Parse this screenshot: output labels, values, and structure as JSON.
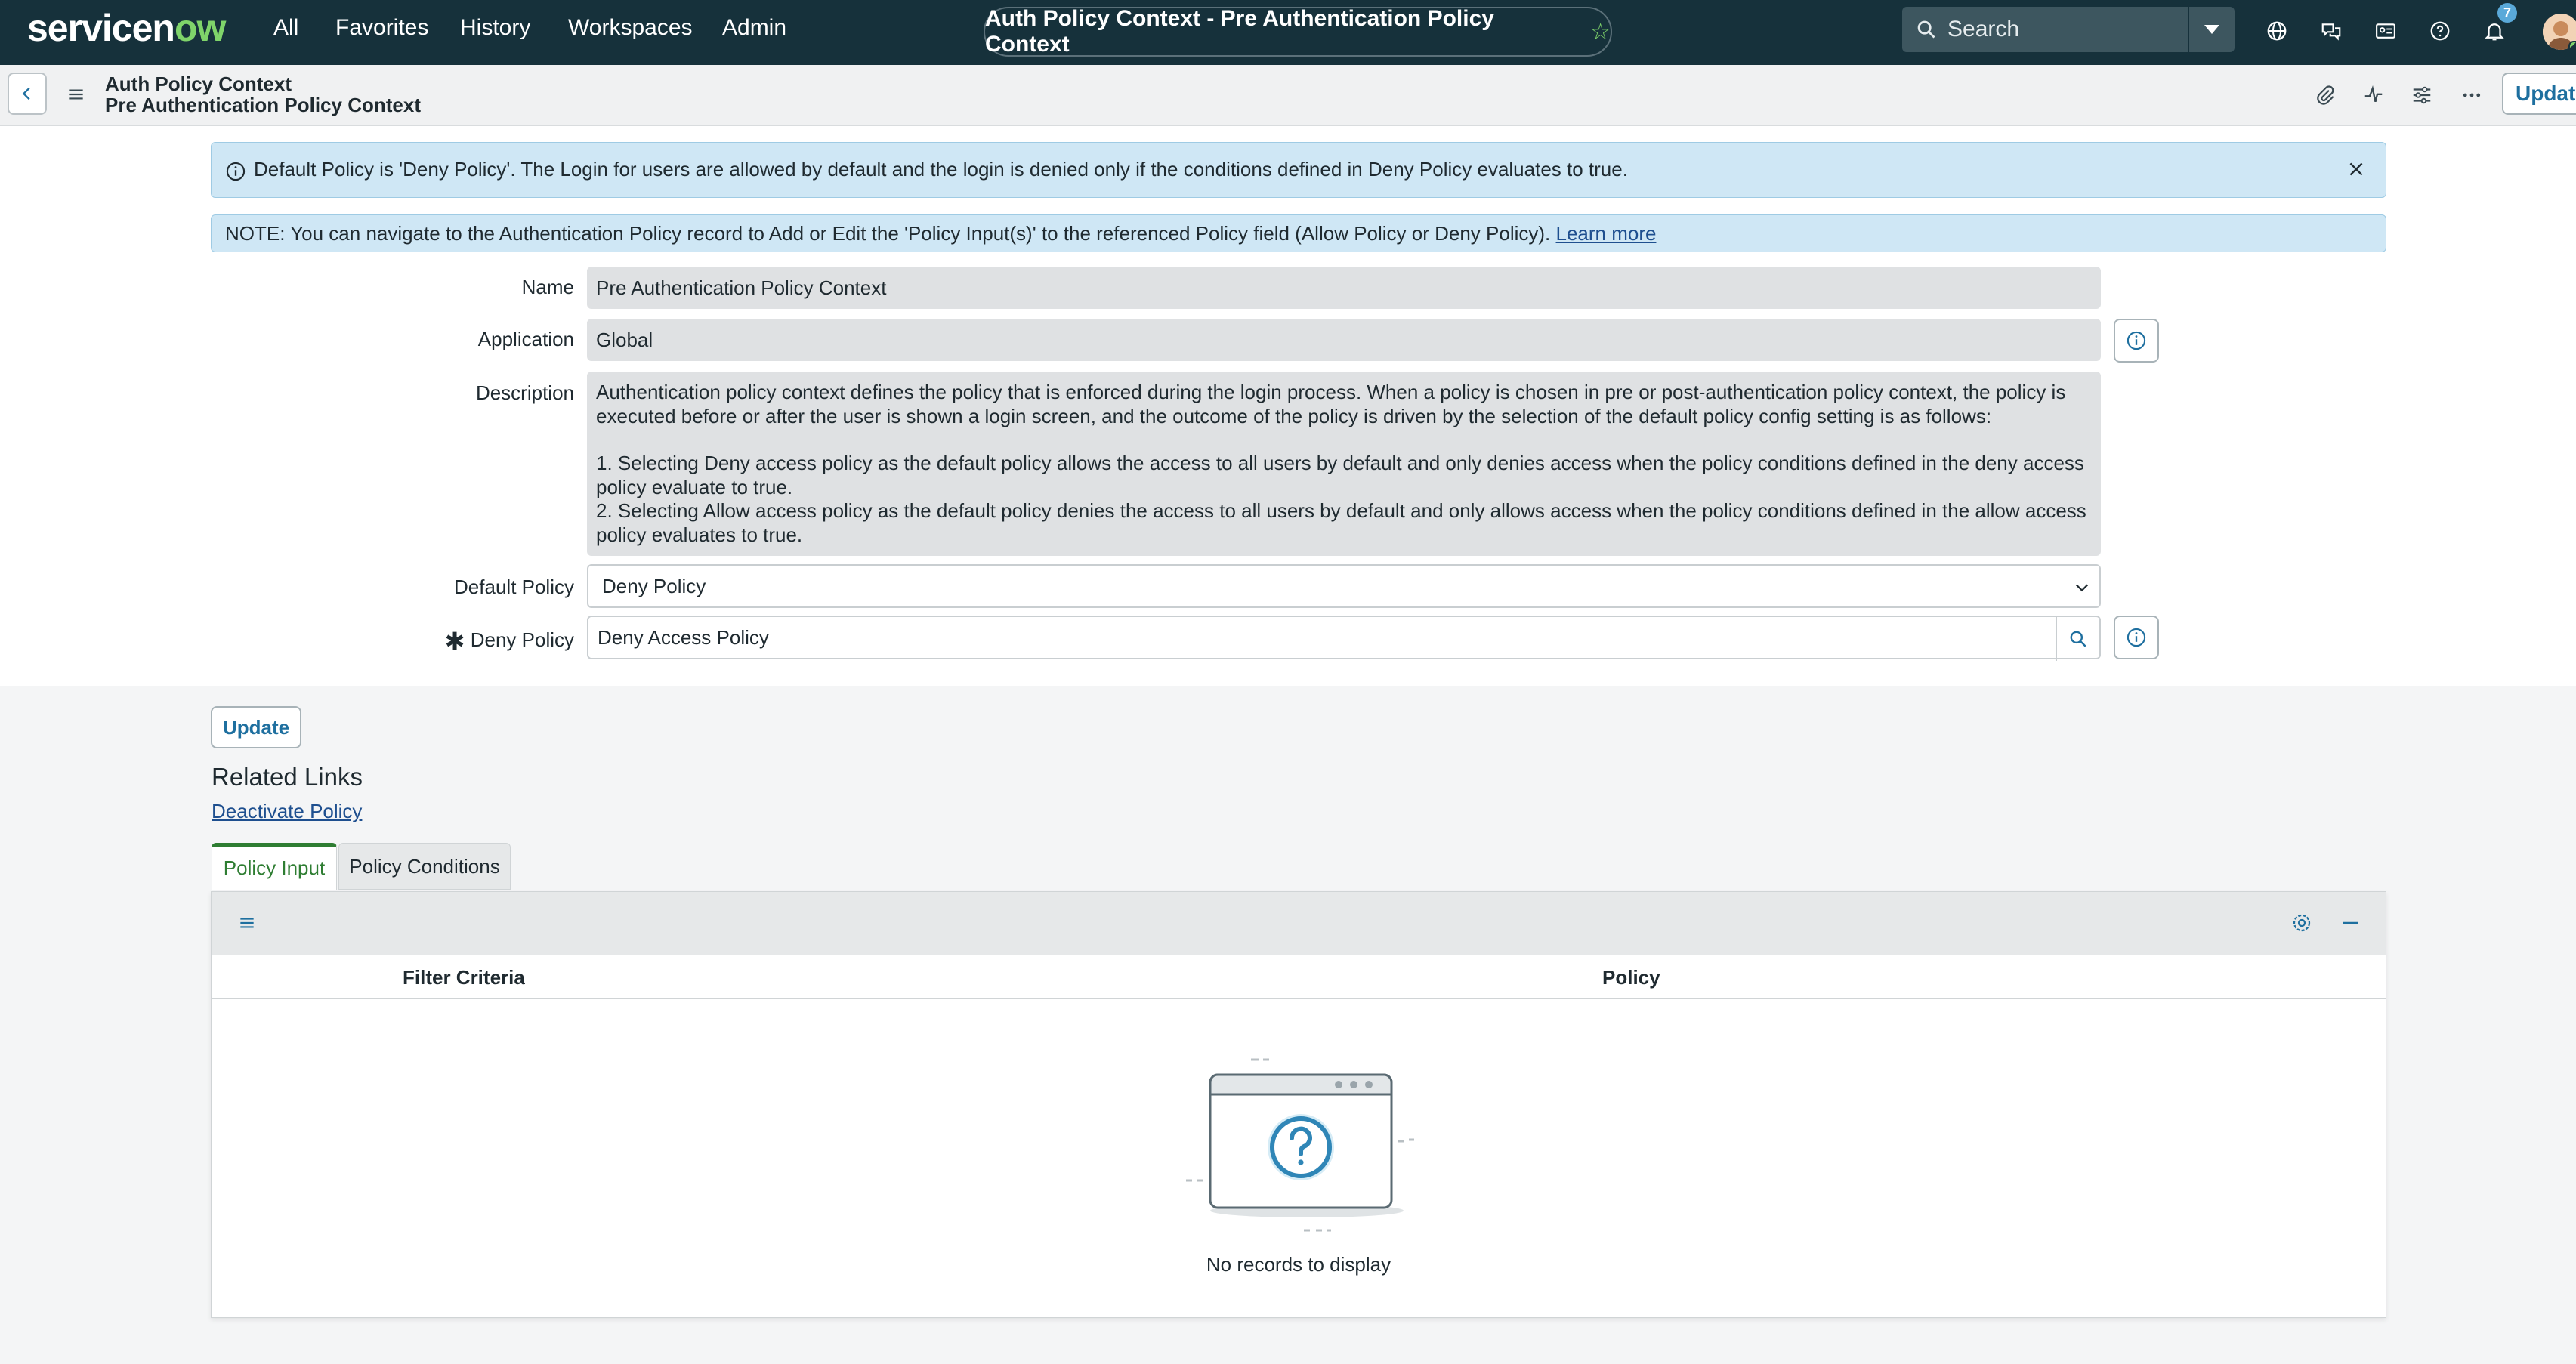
{
  "colors": {
    "nav_bg": "#16313b",
    "accent_green": "#7fd46a",
    "link_blue": "#1e4f8f",
    "banner_bg": "#cfe7f5",
    "tab_active": "#2e7d32"
  },
  "topnav": {
    "logo_pre": "servicen",
    "logo_ow": "ow",
    "items": [
      "All",
      "Favorites",
      "History",
      "Workspaces",
      "Admin"
    ],
    "record_title": "Auth Policy Context - Pre Authentication Policy Context",
    "search_placeholder": "Search",
    "notification_count": "7",
    "icons": [
      "globe-icon",
      "chat-icon",
      "id-card-icon",
      "help-icon",
      "bell-icon"
    ]
  },
  "formbar": {
    "table_label": "Auth Policy Context",
    "record_label": "Pre Authentication Policy Context",
    "update_label": "Update"
  },
  "banners": {
    "info": "Default Policy is 'Deny Policy'. The Login for users are allowed by default and the login is denied only if the conditions defined in Deny Policy evaluates to true.",
    "note": "NOTE: You can navigate to the Authentication Policy record to Add or Edit the 'Policy Input(s)' to the referenced Policy field (Allow Policy or Deny Policy).",
    "note_link": "Learn more"
  },
  "form": {
    "name_label": "Name",
    "name_value": "Pre Authentication Policy Context",
    "application_label": "Application",
    "application_value": "Global",
    "description_label": "Description",
    "description_p1": "Authentication policy context defines the policy that is enforced during the login process. When a policy is chosen in pre or post-authentication policy context, the policy is executed before or after the user is shown a login screen, and the outcome of the policy is driven by the selection of the default policy config setting is as follows:",
    "description_p2": "1. Selecting Deny access policy as the default policy allows the access to all users by default and only denies access when the policy conditions defined in the deny access policy evaluate to true.",
    "description_p3": "2. Selecting Allow access policy as the default policy denies the access to all users by default and only allows access when the policy conditions defined in the allow access policy evaluates to true.",
    "default_policy_label": "Default Policy",
    "default_policy_value": "Deny Policy",
    "deny_policy_label": "Deny Policy",
    "deny_policy_value": "Deny Access Policy"
  },
  "actions": {
    "update_label": "Update"
  },
  "related": {
    "heading": "Related Links",
    "link": "Deactivate Policy"
  },
  "tabs": [
    {
      "label": "Policy Input"
    },
    {
      "label": "Policy Conditions"
    }
  ],
  "list": {
    "columns": [
      "Filter Criteria",
      "Policy"
    ],
    "empty_text": "No records to display"
  }
}
